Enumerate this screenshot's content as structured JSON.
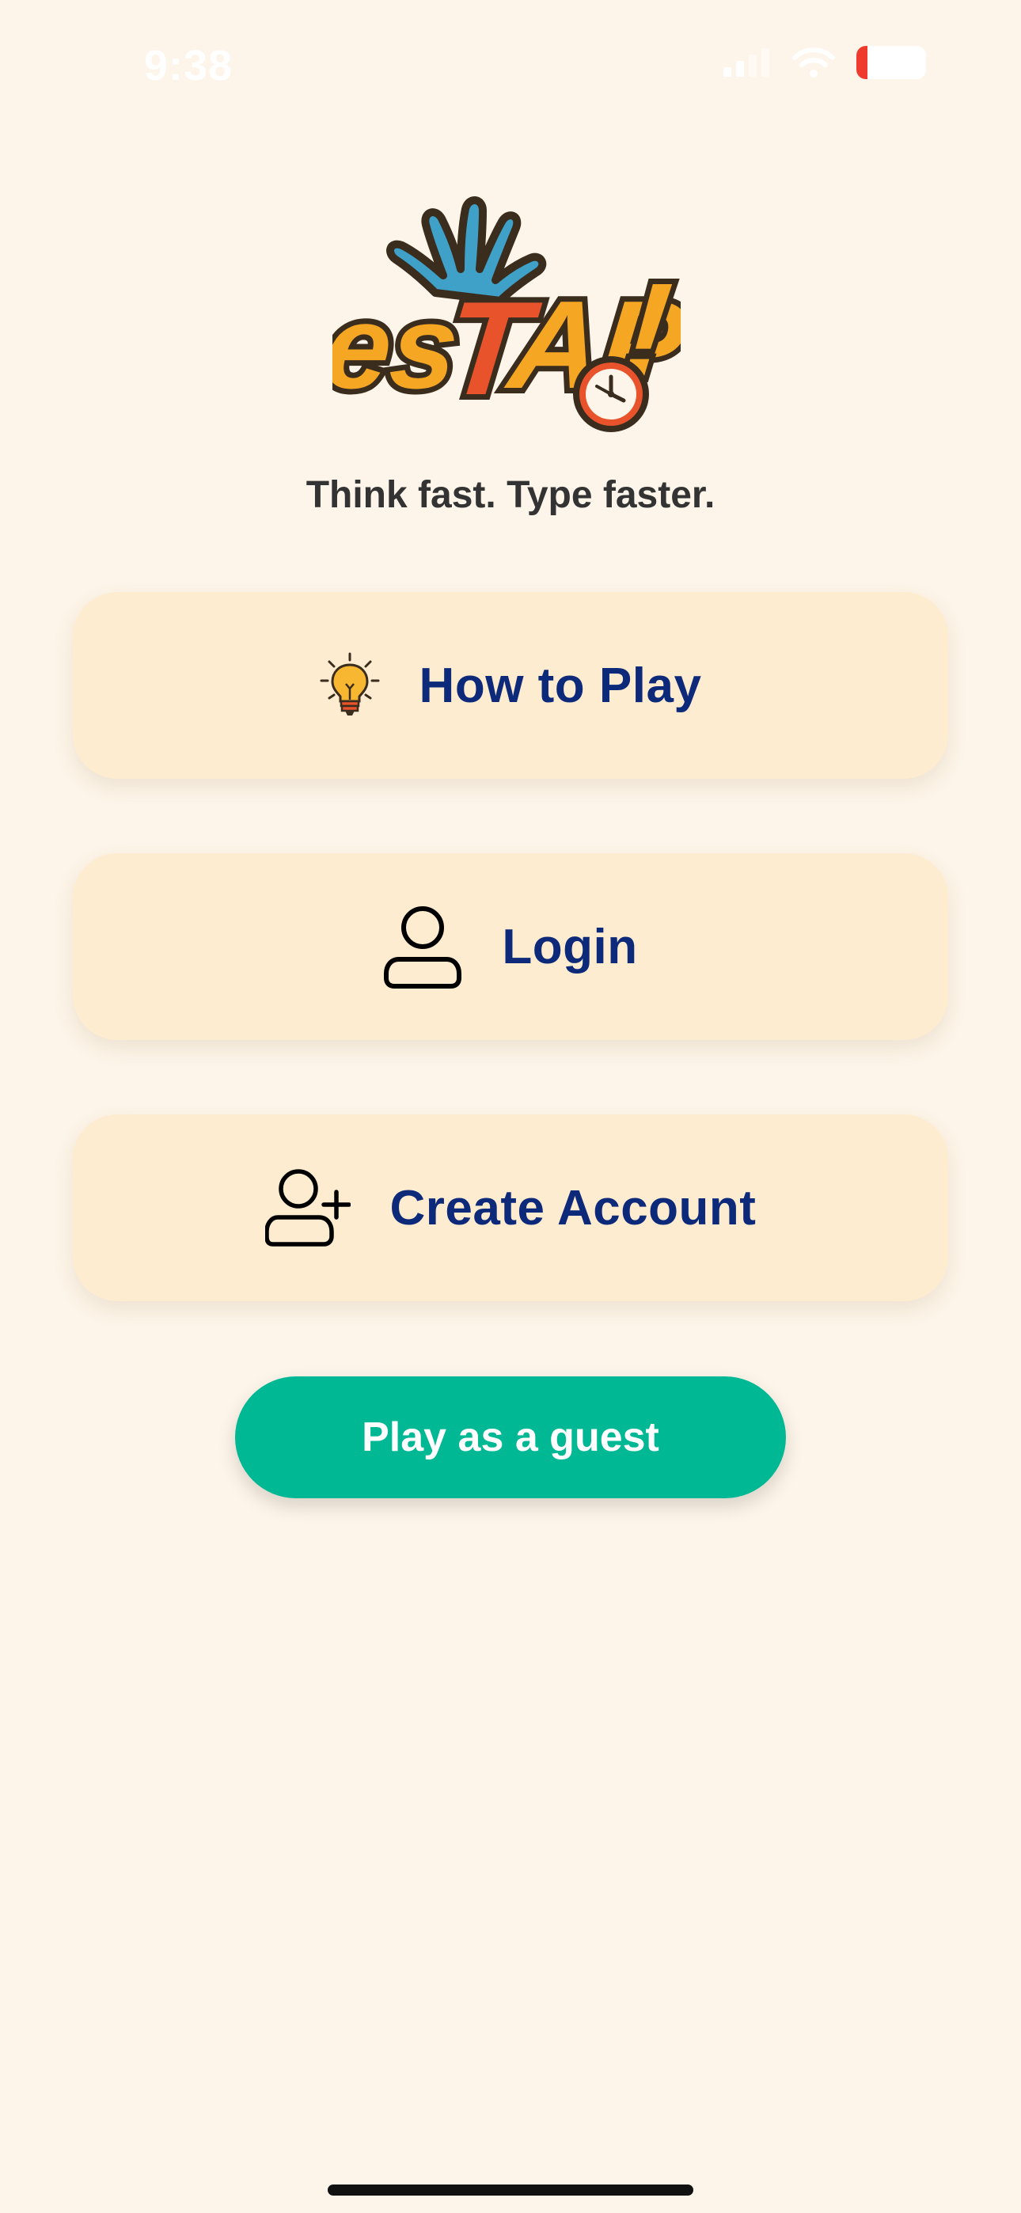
{
  "status_bar": {
    "time": "9:38",
    "battery_level": "16"
  },
  "logo": {
    "brand": "esTAP!"
  },
  "tagline": "Think fast. Type faster.",
  "menu": [
    {
      "label": "How to Play",
      "icon": "lightbulb-icon"
    },
    {
      "label": "Login",
      "icon": "user-icon"
    },
    {
      "label": "Create Account",
      "icon": "user-plus-icon"
    }
  ],
  "guest_button": {
    "label": "Play as a guest"
  },
  "colors": {
    "background": "#fdf5e9",
    "card": "#feecd0",
    "card_text": "#0d2a7a",
    "accent_green": "#00b894",
    "logo_orange": "#f5a623",
    "logo_red": "#e8532b",
    "logo_blue": "#3fa0c8",
    "logo_outline": "#4a3a28"
  }
}
